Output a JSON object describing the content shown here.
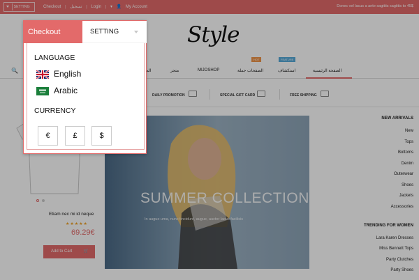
{
  "topbar": {
    "setting_label": "SETTING",
    "links": [
      "Checkout",
      "تسجيل",
      "Login",
      "My Account"
    ],
    "promo_text": "Donec vel lacus a ante sagittis sagittis to 45$"
  },
  "logo_text": "Style",
  "nav": {
    "items": [
      "الصفحة الرئيسية",
      "استكشاف",
      "الصفحات جملة",
      "MIJOSHOP",
      "متجر",
      "الم"
    ],
    "badges": [
      "HOT",
      "FEATURE"
    ]
  },
  "services": [
    "DAILY PROMOTION",
    "SPECIAL GIFT CARD",
    "FREE SHIPPING"
  ],
  "product": {
    "name": "Etiam nec mi id neque",
    "stars": "★★★★★",
    "price": "69.29€",
    "cart_label": "Add to Cart"
  },
  "banner": {
    "title": "SUMMER COLLECTION",
    "subtitle": "In augue uma, nunc tincidunt, augue, auctor lacus facilisis"
  },
  "sidebar": {
    "new_arrivals_title": "NEW ARRIVALS",
    "new_arrivals": [
      "New",
      "Tops",
      "Bottoms",
      "Denim",
      "Outerwear",
      "Shoes",
      "Jackets",
      "Accessories"
    ],
    "trending_title": "TRENDING FOR WOMEN",
    "trending": [
      "Lara Karen Dresses",
      "Miss Bennett Tops",
      "Party Clutches",
      "Party Shoes"
    ]
  },
  "dropdown": {
    "tab_checkout": "Checkout",
    "tab_setting": "SETTING",
    "language_heading": "LANGUAGE",
    "languages": [
      "English",
      "Arabic"
    ],
    "currency_heading": "CURRENCY",
    "currencies": [
      "€",
      "£",
      "$"
    ]
  },
  "colors": {
    "accent": "#e36a6a",
    "hot_badge": "#f0954a",
    "feature_badge": "#55a9d8",
    "star": "#f0a020"
  }
}
